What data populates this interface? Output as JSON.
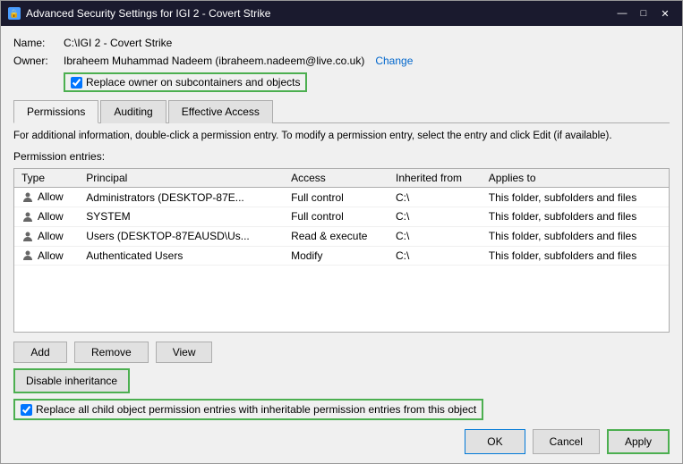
{
  "window": {
    "title": "Advanced Security Settings for IGI 2 - Covert Strike",
    "icon": "🔒"
  },
  "titlebar": {
    "minimize": "—",
    "maximize": "□",
    "close": "✕"
  },
  "fields": {
    "name_label": "Name:",
    "name_value": "C:\\IGI 2 - Covert Strike",
    "owner_label": "Owner:",
    "owner_value": "Ibraheem Muhammad Nadeem (ibraheem.nadeem@live.co.uk)",
    "owner_change": "Change",
    "replace_owner_checkbox_label": "Replace owner on subcontainers and objects",
    "replace_owner_checked": true
  },
  "tabs": [
    {
      "id": "permissions",
      "label": "Permissions",
      "active": true
    },
    {
      "id": "auditing",
      "label": "Auditing",
      "active": false
    },
    {
      "id": "effective-access",
      "label": "Effective Access",
      "active": false
    }
  ],
  "description": "For additional information, double-click a permission entry. To modify a permission entry, select the entry and click Edit (if available).",
  "section_label": "Permission entries:",
  "table": {
    "headers": [
      "Type",
      "Principal",
      "Access",
      "Inherited from",
      "Applies to"
    ],
    "rows": [
      {
        "type": "Allow",
        "principal": "Administrators (DESKTOP-87E...",
        "access": "Full control",
        "inherited_from": "C:\\",
        "applies_to": "This folder, subfolders and files"
      },
      {
        "type": "Allow",
        "principal": "SYSTEM",
        "access": "Full control",
        "inherited_from": "C:\\",
        "applies_to": "This folder, subfolders and files"
      },
      {
        "type": "Allow",
        "principal": "Users (DESKTOP-87EAUSD\\Us...",
        "access": "Read & execute",
        "inherited_from": "C:\\",
        "applies_to": "This folder, subfolders and files"
      },
      {
        "type": "Allow",
        "principal": "Authenticated Users",
        "access": "Modify",
        "inherited_from": "C:\\",
        "applies_to": "This folder, subfolders and files"
      }
    ]
  },
  "buttons": {
    "add": "Add",
    "remove": "Remove",
    "view": "View",
    "disable_inheritance": "Disable inheritance",
    "replace_child_label": "Replace all child object permission entries with inheritable permission entries from this object",
    "replace_child_checked": true,
    "ok": "OK",
    "cancel": "Cancel",
    "apply": "Apply"
  }
}
